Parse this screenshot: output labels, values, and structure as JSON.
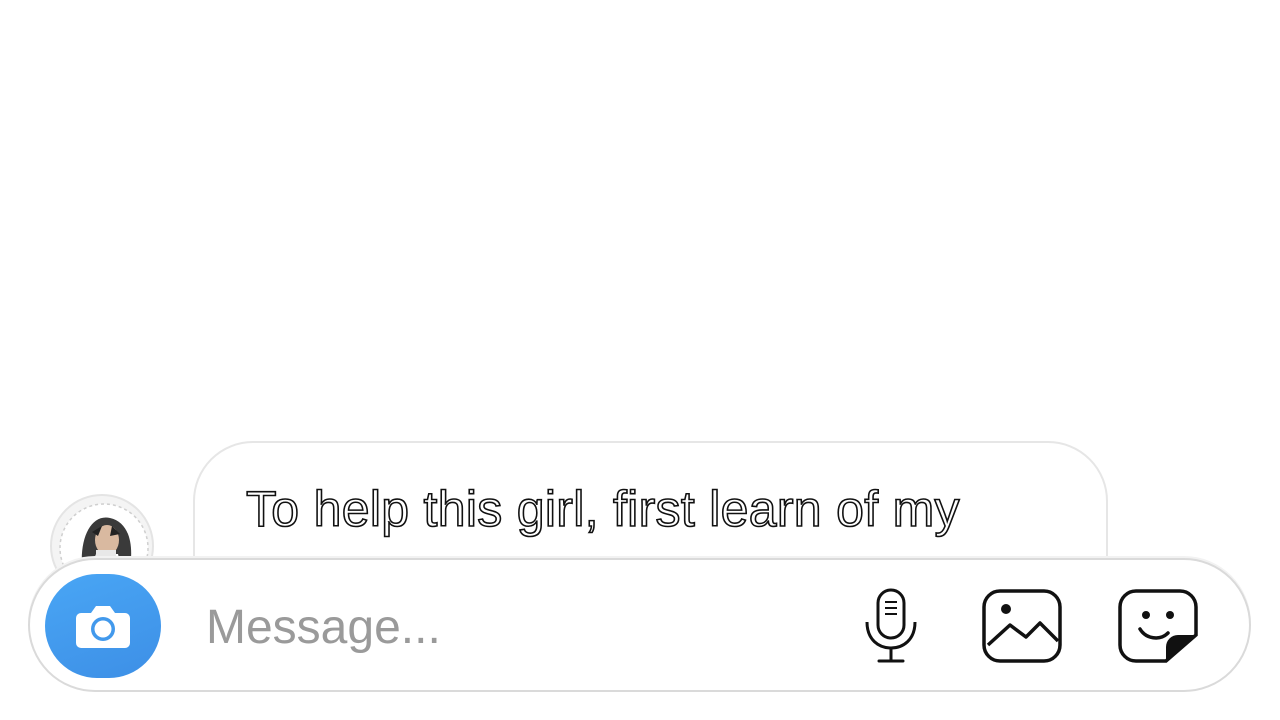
{
  "thread": {
    "avatar_icon": "profile-photo",
    "message_text": "To help this girl, first learn of my"
  },
  "composer": {
    "camera_icon": "camera-icon",
    "placeholder": "Message...",
    "value": "",
    "mic_icon": "microphone-icon",
    "gallery_icon": "gallery-icon",
    "sticker_icon": "sticker-icon"
  },
  "colors": {
    "camera_button": "#3d95ec",
    "placeholder": "#9a9a9a",
    "border": "#dadada"
  }
}
